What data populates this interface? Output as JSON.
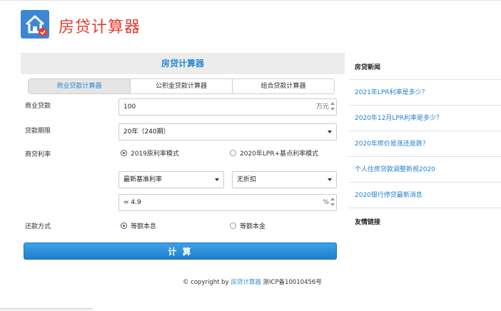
{
  "site": {
    "title": "房贷计算器"
  },
  "calculator": {
    "header": "房贷计算器",
    "tabs": [
      {
        "label": "商业贷款计算器",
        "active": true
      },
      {
        "label": "公积金贷款计算器",
        "active": false
      },
      {
        "label": "组合贷款计算器",
        "active": false
      }
    ],
    "loan": {
      "label": "商业贷款",
      "value": "100",
      "unit": "万元"
    },
    "term": {
      "label": "贷款期限",
      "selected": "20年（240期）"
    },
    "rate": {
      "label": "商贷利率",
      "modes": [
        {
          "label": "2019原利率模式",
          "checked": true
        },
        {
          "label": "2020年LPR+基点利率模式",
          "checked": false
        }
      ],
      "base_select": "最新基准利率",
      "discount_select": "无折扣",
      "value": "= 4.9",
      "unit": "%"
    },
    "repayment": {
      "label": "还款方式",
      "options": [
        {
          "label": "等额本息",
          "checked": true
        },
        {
          "label": "等额本金",
          "checked": false
        }
      ]
    },
    "submit_label": "计 算"
  },
  "footer": {
    "prefix": "© copyright by ",
    "link": "房贷计算器",
    "suffix": " 浙ICP备10010456号"
  },
  "sidebar": {
    "heading": "房贷新闻",
    "items": [
      "2021年LPR利率是多少？",
      "2020年12月LPR利率是多少？",
      "2020年房价是涨还是跌？",
      "个人住房贷款调整新规2020",
      "2020银行停贷最新消息"
    ],
    "friends_heading": "友情链接"
  },
  "colors": {
    "accent": "#2a8ad4",
    "brand_red": "#e63b2e",
    "logo_blue": "#3d86d4"
  }
}
